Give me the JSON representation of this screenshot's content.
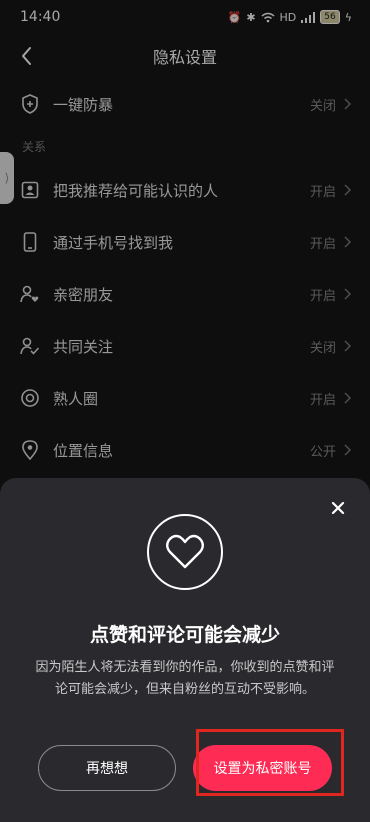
{
  "status_bar": {
    "time": "14:40",
    "battery": "56"
  },
  "header": {
    "title": "隐私设置"
  },
  "items": [
    {
      "label": "一键防暴",
      "value": "关闭"
    }
  ],
  "section": {
    "title": "关系"
  },
  "relation_items": [
    {
      "label": "把我推荐给可能认识的人",
      "value": "开启",
      "icon": "contact-card-icon"
    },
    {
      "label": "通过手机号找到我",
      "value": "开启",
      "icon": "phone-icon"
    },
    {
      "label": "亲密朋友",
      "value": "开启",
      "icon": "user-heart-icon"
    },
    {
      "label": "共同关注",
      "value": "关闭",
      "icon": "user-check-icon"
    },
    {
      "label": "熟人圈",
      "value": "开启",
      "icon": "circle-icon"
    },
    {
      "label": "位置信息",
      "value": "公开",
      "icon": "location-icon"
    }
  ],
  "dialog": {
    "title": "点赞和评论可能会减少",
    "description": "因为陌生人将无法看到你的作品，你收到的点赞和评论可能会减少，但来自粉丝的互动不受影响。",
    "cancel_label": "再想想",
    "confirm_label": "设置为私密账号"
  },
  "colors": {
    "accent": "#fe2c55",
    "highlight": "#e0261e",
    "background": "#161616",
    "sheet": "#2a2a2e"
  }
}
